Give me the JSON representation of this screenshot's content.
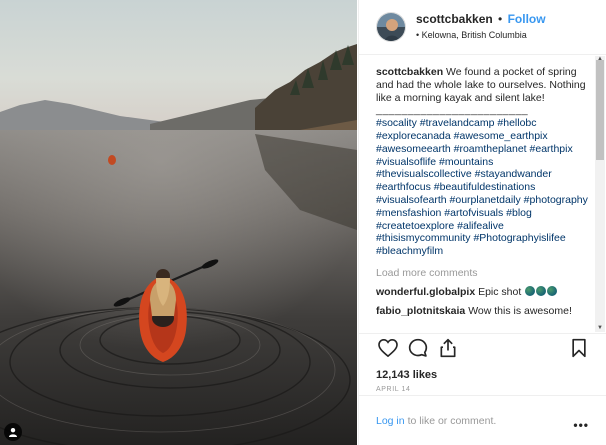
{
  "post": {
    "username": "scottcbakken",
    "follow_label": "Follow",
    "separator": "•",
    "location": "Kelowna, British Columbia",
    "location_marker": "•"
  },
  "caption": {
    "username": "scottcbakken",
    "text": "We found a pocket of spring and had the whole lake to ourselves. Nothing like a morning kayak and silent lake!",
    "divider": "________________________",
    "hashtags": "#socality #travelandcamp #hellobc #explorecanada #awesome_earthpix #awesomeearth #roamtheplanet #earthpix #visualsoflife #mountains #thevisualscollective #stayandwander #earthfocus #beautifuldestinations #visualsofearth #ourplanetdaily #photography #mensfashion #artofvisuals #blog #createtoexplore #alifealive #thisismycommunity #Photographyislifee #bleachmyfilm"
  },
  "load_more_label": "Load more comments",
  "comments": [
    {
      "username": "wonderful.globalpix",
      "text": "Epic shot"
    },
    {
      "username": "fabio_plotnitskaia",
      "text": "Wow this is awesome!"
    }
  ],
  "likes": "12,143 likes",
  "date": "APRIL 14",
  "login": {
    "link": "Log in",
    "text": "to like or comment.",
    "more": "•••"
  },
  "scroll": {
    "up": "▲",
    "down": "▼"
  },
  "icons": {
    "like": "heart-icon",
    "comment": "comment-icon",
    "share": "share-icon",
    "save": "bookmark-icon",
    "user_tag": "user-tag-icon"
  },
  "colors": {
    "link_blue": "#3897f0",
    "hashtag_blue": "#003569",
    "muted": "#999999",
    "kayak": "#d4461f"
  }
}
